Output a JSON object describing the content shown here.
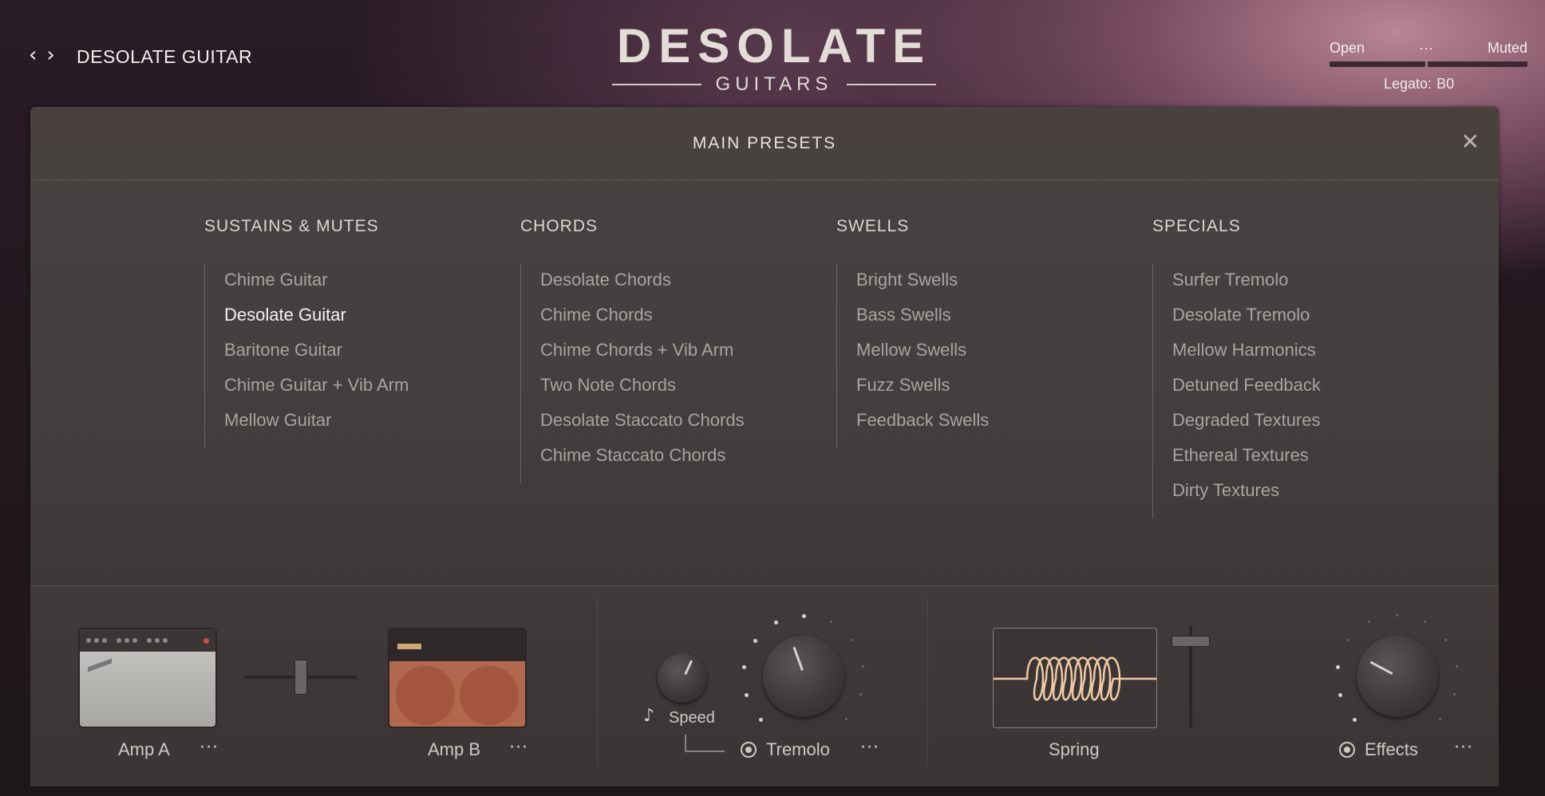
{
  "header": {
    "preset_name": "DESOLATE GUITAR",
    "nav_prev": "‹",
    "nav_next": "›",
    "logo_main": "DESOLATE",
    "logo_sub": "GUITARS",
    "articulation": {
      "left": "Open",
      "middle": "···",
      "right": "Muted"
    },
    "legato_label": "Legato:",
    "legato_value": "B0"
  },
  "panel": {
    "title": "MAIN PRESETS",
    "close": "✕",
    "columns": [
      {
        "title": "SUSTAINS & MUTES",
        "items": [
          "Chime Guitar",
          "Desolate Guitar",
          "Baritone Guitar",
          "Chime Guitar + Vib Arm",
          "Mellow Guitar"
        ]
      },
      {
        "title": "CHORDS",
        "items": [
          "Desolate Chords",
          "Chime Chords",
          "Chime Chords + Vib Arm",
          "Two Note Chords",
          "Desolate Staccato Chords",
          "Chime Staccato Chords"
        ]
      },
      {
        "title": "SWELLS",
        "items": [
          "Bright Swells",
          "Bass Swells",
          "Mellow Swells",
          "Fuzz Swells",
          "Feedback Swells"
        ]
      },
      {
        "title": "SPECIALS",
        "items": [
          "Surfer Tremolo",
          "Desolate Tremolo",
          "Mellow Harmonics",
          "Detuned Feedback",
          "Degraded Textures",
          "Ethereal Textures",
          "Dirty Textures"
        ]
      }
    ],
    "active_item": "Desolate Guitar"
  },
  "fx": {
    "amp_a": "Amp A",
    "amp_b": "Amp B",
    "speed": "Speed",
    "tremolo": "Tremolo",
    "spring": "Spring",
    "effects": "Effects",
    "more": "···",
    "amp_fader_position": 0.5,
    "spring_fader_position": 0.15
  },
  "colors": {
    "accent_text": "#f6f2ee",
    "item_text": "#aaa39d",
    "amp_b_body": "#b1684f",
    "spring_glow": "#f0c9a6"
  }
}
